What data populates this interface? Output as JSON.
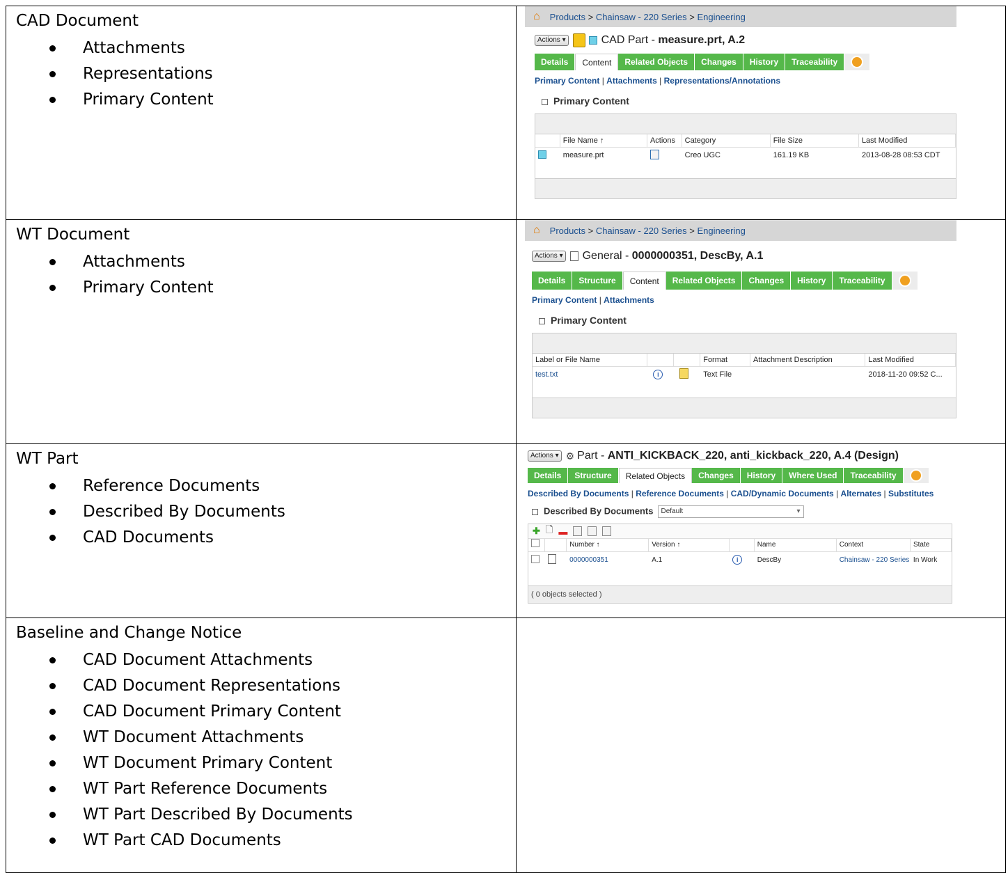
{
  "rows": [
    {
      "title": "CAD Document",
      "items": [
        "Attachments",
        "Representations",
        "Primary Content"
      ],
      "shot": {
        "breadcrumb": [
          "Products",
          "Chainsaw - 220 Series",
          "Engineering"
        ],
        "actions": "Actions",
        "type": "CAD Part - ",
        "name": "measure.prt, A.2",
        "tabs": [
          "Details",
          "Content",
          "Related Objects",
          "Changes",
          "History",
          "Traceability"
        ],
        "active_tab": "Content",
        "sublinks": [
          "Primary Content",
          "Attachments",
          "Representations/Annotations"
        ],
        "section": "Primary Content",
        "columns": [
          "",
          "File Name ↑",
          "Actions",
          "Category",
          "File Size",
          "Last Modified"
        ],
        "row": [
          "",
          "measure.prt",
          "",
          "Creo UGC",
          "161.19 KB",
          "2013-08-28 08:53 CDT"
        ]
      }
    },
    {
      "title": "WT Document",
      "items": [
        "Attachments",
        "Primary Content"
      ],
      "shot": {
        "breadcrumb": [
          "Products",
          "Chainsaw - 220 Series",
          "Engineering"
        ],
        "actions": "Actions",
        "type": "General - ",
        "name": "0000000351, DescBy, A.1",
        "tabs": [
          "Details",
          "Structure",
          "Content",
          "Related Objects",
          "Changes",
          "History",
          "Traceability"
        ],
        "active_tab": "Content",
        "sublinks": [
          "Primary Content",
          "Attachments"
        ],
        "section": "Primary Content",
        "columns": [
          "Label or File Name",
          "",
          "",
          "Format",
          "Attachment Description",
          "Last Modified"
        ],
        "row": [
          "test.txt",
          "",
          "",
          "Text File",
          "",
          "2018-11-20 09:52 C..."
        ]
      }
    },
    {
      "title": "WT Part",
      "items": [
        "Reference Documents",
        "Described By Documents",
        "CAD Documents"
      ],
      "shot": {
        "actions": "Actions",
        "type": "Part - ",
        "name": "ANTI_KICKBACK_220, anti_kickback_220, A.4 (Design)",
        "tabs": [
          "Details",
          "Structure",
          "Related Objects",
          "Changes",
          "History",
          "Where Used",
          "Traceability"
        ],
        "active_tab": "Related Objects",
        "sublinks": [
          "Described By Documents",
          "Reference Documents",
          "CAD/Dynamic Documents",
          "Alternates",
          "Substitutes"
        ],
        "section": "Described By Documents",
        "view": "Default",
        "columns": [
          "",
          "",
          "Number ↑",
          "Version ↑",
          "",
          "Name",
          "Context",
          "State"
        ],
        "row": [
          "",
          "",
          "0000000351",
          "A.1",
          "",
          "DescBy",
          "Chainsaw - 220 Series",
          "In Work"
        ],
        "footer": "( 0 objects selected )"
      }
    },
    {
      "title": "Baseline and Change Notice",
      "items": [
        "CAD Document Attachments",
        "CAD Document Representations",
        "CAD Document Primary Content",
        "WT Document Attachments",
        "WT Document Primary Content",
        "WT Part Reference Documents",
        "WT Part Described By Documents",
        "WT Part CAD Documents"
      ]
    }
  ]
}
